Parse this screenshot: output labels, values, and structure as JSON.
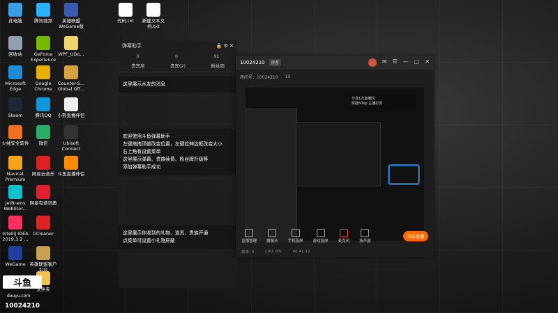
{
  "desktop_icons": [
    {
      "label": "此电脑",
      "color": "#3aa0e6"
    },
    {
      "label": "腾讯视频",
      "color": "#2ab0ff"
    },
    {
      "label": "英雄联盟\nWeGame版",
      "color": "#3a5ab0"
    },
    {
      "label": "回收站",
      "color": "#8fa0b0"
    },
    {
      "label": "GeForce\nExperience",
      "color": "#76b900"
    },
    {
      "label": "WPF_UDo...",
      "color": "#f2d46b"
    },
    {
      "label": "Microsoft\nEdge",
      "color": "#1f8cd8"
    },
    {
      "label": "Google\nChrome",
      "color": "#e7b000"
    },
    {
      "label": "Counter-S...\nGlobal Off...",
      "color": "#d8a040"
    },
    {
      "label": "Steam",
      "color": "#1b2838"
    },
    {
      "label": "腾讯QQ",
      "color": "#1296db"
    },
    {
      "label": "小熊直播伴侣",
      "color": "#eeeeee"
    },
    {
      "label": "火绒安全软件",
      "color": "#f07020"
    },
    {
      "label": "微信",
      "color": "#2aae67"
    },
    {
      "label": "Ubisoft\nConnect",
      "color": "#333333"
    },
    {
      "label": "Navicat\nPremium",
      "color": "#f7a21b"
    },
    {
      "label": "网易云音乐",
      "color": "#e02020"
    },
    {
      "label": "斗鱼直播伴侣",
      "color": "#ff8a00"
    },
    {
      "label": "JetBrains\nWebStor...",
      "color": "#14c0d0"
    },
    {
      "label": "网易有道词典",
      "color": "#e02030"
    },
    {
      "label": "IntelliJ IDEA\n2019.3.2 ...",
      "color": "#fe315d"
    },
    {
      "label": "CCleaner",
      "color": "#d22"
    },
    {
      "label": "WeGame",
      "color": "#2040a0"
    },
    {
      "label": "英雄联盟客户\n平台",
      "color": "#c8a050"
    },
    {
      "label": "代码.txt",
      "color": "#ffffff"
    },
    {
      "label": "新建文本文\n档.txt",
      "color": "#ffffff"
    },
    {
      "label": "文件夹",
      "color": "#f2c14e"
    }
  ],
  "logo": {
    "brand": "斗鱼",
    "sub": "douyu.com",
    "room_id": "10024210"
  },
  "helper": {
    "title": "弹幕助手",
    "stats": [
      "0",
      "0",
      "91"
    ],
    "tabs": [
      "贵宾席",
      "贵宾(2)",
      "粉丝团"
    ],
    "msg1": "这里展示水友的消息",
    "msg2": "欢迎使用斗鱼弹幕助手\n左键拖拽顶部改变位置，左键拉伸边框改变大小\n右上角有设置菜单\n这里展示弹幕、贵族续费、粉丝牌升级等\n添加弹幕助手成功",
    "msg3": "这里展示你收到的礼物、道具、贵族开通\n点菜单可设置小礼物屏蔽"
  },
  "window": {
    "room_id": "10024210",
    "room_tag": "房客",
    "sub_items": [
      "房间号：10024210",
      "19"
    ],
    "toolbar": [
      "直播管理",
      "摄像头",
      "手机投屏",
      "游戏投屏",
      "麦克风",
      "扬声器"
    ],
    "go_live": "开启直播",
    "status": [
      "帧率: 0",
      "CPU: 0%",
      "00:41:12"
    ],
    "overlay_title": "分享1次直播间",
    "overlay_sub": "奖励50ep 主播打赏"
  }
}
